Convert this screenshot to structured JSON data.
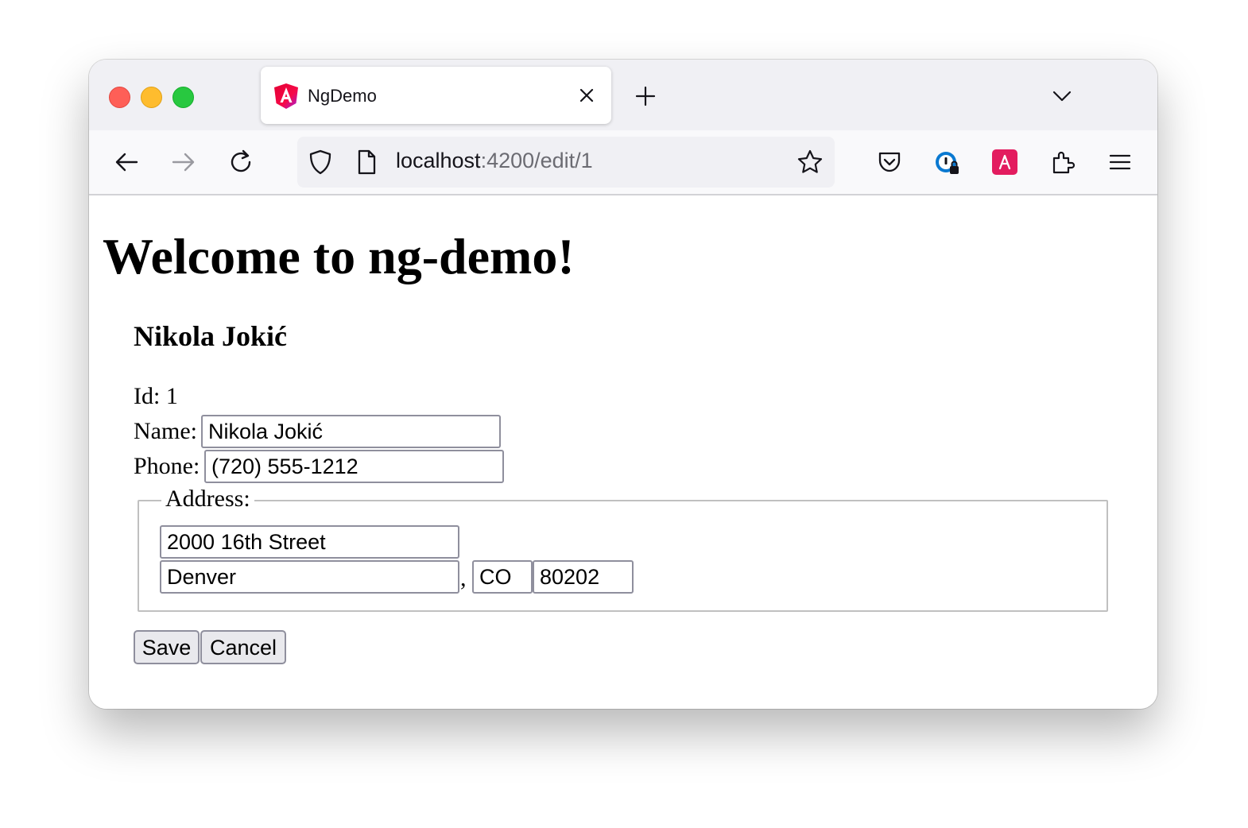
{
  "browser": {
    "tab": {
      "title": "NgDemo",
      "favicon": "angular-logo-icon"
    },
    "url": {
      "host": "localhost",
      "path": ":4200/edit/1"
    },
    "icons": {
      "back": "arrow-left-icon",
      "forward": "arrow-right-icon",
      "reload": "reload-icon",
      "shield": "shield-icon",
      "page": "page-icon",
      "bookmark": "star-icon",
      "pocket": "pocket-icon",
      "password_manager": "password-manager-icon",
      "extension_red": "red-extension-icon",
      "extensions": "puzzle-icon",
      "menu": "hamburger-menu-icon"
    }
  },
  "page": {
    "heading": "Welcome to ng-demo!",
    "record_title": "Nikola Jokić",
    "id_line": "Id: 1",
    "name_label": "Name:",
    "name_value": "Nikola Jokić",
    "phone_label": "Phone:",
    "phone_value": "(720) 555-1212",
    "address_legend": "Address:",
    "street_value": "2000 16th Street",
    "city_value": "Denver",
    "comma": ",",
    "state_value": "CO",
    "zip_value": "80202",
    "save_label": "Save",
    "cancel_label": "Cancel"
  },
  "colors": {
    "accent_red": "#e31c5f",
    "traffic_red": "#fe5f57",
    "traffic_yellow": "#febc2e",
    "traffic_green": "#28c840"
  }
}
